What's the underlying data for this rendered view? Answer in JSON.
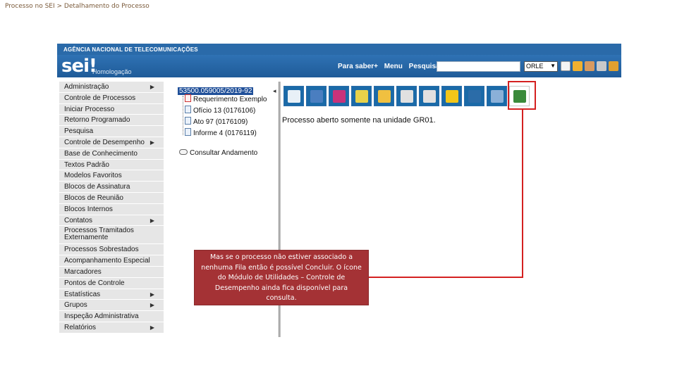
{
  "breadcrumb": "Processo no SEI > Detalhamento do Processo",
  "header": {
    "agency": "AGÊNCIA NACIONAL DE TELECOMUNICAÇÕES",
    "logo": "sei!",
    "environment": "Homologação",
    "links": [
      "Para saber+",
      "Menu",
      "Pesquisa"
    ],
    "unit": "ORLE",
    "search_value": ""
  },
  "menu": {
    "items": [
      {
        "label": "Administração",
        "has_submenu": true
      },
      {
        "label": "Controle de Processos",
        "has_submenu": false
      },
      {
        "label": "Iniciar Processo",
        "has_submenu": false
      },
      {
        "label": "Retorno Programado",
        "has_submenu": false
      },
      {
        "label": "Pesquisa",
        "has_submenu": false
      },
      {
        "label": "Controle de Desempenho",
        "has_submenu": true
      },
      {
        "label": "Base de Conhecimento",
        "has_submenu": false
      },
      {
        "label": "Textos Padrão",
        "has_submenu": false
      },
      {
        "label": "Modelos Favoritos",
        "has_submenu": false
      },
      {
        "label": "Blocos de Assinatura",
        "has_submenu": false
      },
      {
        "label": "Blocos de Reunião",
        "has_submenu": false
      },
      {
        "label": "Blocos Internos",
        "has_submenu": false
      },
      {
        "label": "Contatos",
        "has_submenu": true
      },
      {
        "label": "Processos Tramitados Externamente",
        "has_submenu": false,
        "tall": true
      },
      {
        "label": "Processos Sobrestados",
        "has_submenu": false
      },
      {
        "label": "Acompanhamento Especial",
        "has_submenu": false
      },
      {
        "label": "Marcadores",
        "has_submenu": false
      },
      {
        "label": "Pontos de Controle",
        "has_submenu": false
      },
      {
        "label": "Estatísticas",
        "has_submenu": true
      },
      {
        "label": "Grupos",
        "has_submenu": true
      },
      {
        "label": "Inspeção Administrativa",
        "has_submenu": false
      },
      {
        "label": "Relatórios",
        "has_submenu": true
      }
    ]
  },
  "tree": {
    "root": "53500.059005/2019-92",
    "items": [
      {
        "label": "Requerimento Exemplo",
        "type": "pdf"
      },
      {
        "label": "Ofício 13 (0176106)",
        "type": "doc"
      },
      {
        "label": "Ato 97 (0176109)",
        "type": "doc"
      },
      {
        "label": "Informe 4 (0176119)",
        "type": "doc"
      }
    ],
    "consult": "Consultar Andamento"
  },
  "toolbar": {
    "buttons": [
      {
        "icon": "send-process-icon",
        "color": "#e8f0f7"
      },
      {
        "icon": "assign-process-icon",
        "color": "#4a7ec0"
      },
      {
        "icon": "eye-icon",
        "color": "#c8327a"
      },
      {
        "icon": "certificate-icon",
        "color": "#e8d24a"
      },
      {
        "icon": "folder-icon",
        "color": "#f0c040"
      },
      {
        "icon": "pdf-generate-icon",
        "color": "#e0e0e0"
      },
      {
        "icon": "zip-generate-icon",
        "color": "#e0e0e0"
      },
      {
        "icon": "flag-icon",
        "color": "#f2c619"
      },
      {
        "icon": "list-icon",
        "color": "#2b6ca8"
      },
      {
        "icon": "magnifier-icon",
        "color": "#8ab0d8"
      },
      {
        "icon": "utilities-module-icon",
        "color": "#3a8a3a"
      }
    ]
  },
  "status_message": "Processo aberto somente na unidade GR01.",
  "callout": {
    "text": "Mas se o processo não estiver associado a nenhuma Fila então é possível Concluir. O ícone do Módulo de Utilidades – Controle de Desempenho ainda fica disponível para consulta."
  },
  "colors": {
    "header_blue": "#2a6aa9",
    "menu_bg": "#e6e6e6",
    "callout_bg": "#a43235",
    "highlight_red": "#d42020"
  }
}
